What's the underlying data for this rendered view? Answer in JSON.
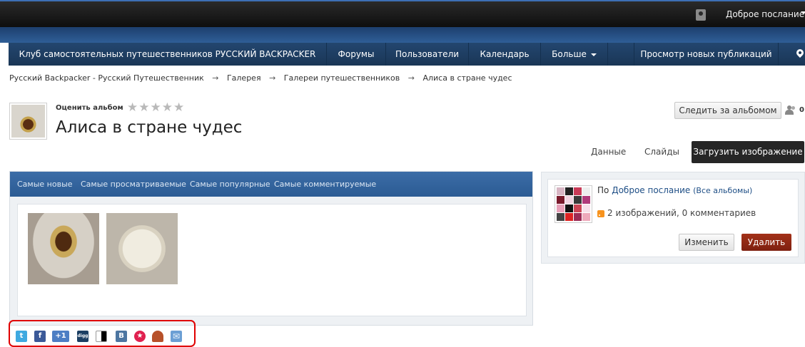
{
  "topbar": {
    "user_name": "Доброе послание"
  },
  "nav": {
    "items": [
      {
        "label": "Клуб самостоятельных путешественников РУССКИЙ BACKPACKER"
      },
      {
        "label": "Форумы"
      },
      {
        "label": "Пользователи"
      },
      {
        "label": "Календарь"
      },
      {
        "label": "Больше"
      },
      {
        "label": "Просмотр новых публикаций"
      }
    ]
  },
  "breadcrumb": {
    "items": [
      "Русский Backpacker - Русский Путешественник",
      "Галерея",
      "Галереи путешественников",
      "Алиса в стране чудес"
    ],
    "separator": "→"
  },
  "album": {
    "rate_label": "Оценить альбом",
    "stars": "★★★★★",
    "title": "Алиса в стране чудес",
    "follow_label": "Следить за альбомом",
    "followers": "0"
  },
  "actions": {
    "data_tab": "Данные",
    "slides_tab": "Слайды",
    "upload": "Загрузить изображение"
  },
  "gallery": {
    "tabs": [
      "Самые новые",
      "Самые просматриваемые",
      "Самые популярные",
      "Самые комментируемые"
    ]
  },
  "owner": {
    "by": "По",
    "name": "Доброе послание",
    "all_albums": "(Все альбомы)",
    "stats": "2 изображений, 0 комментариев",
    "edit": "Изменить",
    "delete": "Удалить"
  },
  "share": {
    "icons": [
      {
        "name": "twitter-icon",
        "glyph": "t",
        "color": "#3fa9e0"
      },
      {
        "name": "facebook-icon",
        "glyph": "f",
        "color": "#3b5998"
      },
      {
        "name": "google-plus-one-icon",
        "glyph": "+1",
        "color": "#4d7ec4"
      },
      {
        "name": "digg-icon",
        "glyph": "digg",
        "color": "#1c3f63"
      },
      {
        "name": "delicious-icon",
        "glyph": "",
        "color": "#ffffff"
      },
      {
        "name": "vkontakte-icon",
        "glyph": "B",
        "color": "#4d76a1"
      },
      {
        "name": "mail-ru-star-icon",
        "glyph": "★",
        "color": "#e0204f"
      },
      {
        "name": "odnoklassniki-icon",
        "glyph": "",
        "color": "#b7512a"
      },
      {
        "name": "email-icon",
        "glyph": "✉",
        "color": "#6b9fd4"
      }
    ]
  }
}
